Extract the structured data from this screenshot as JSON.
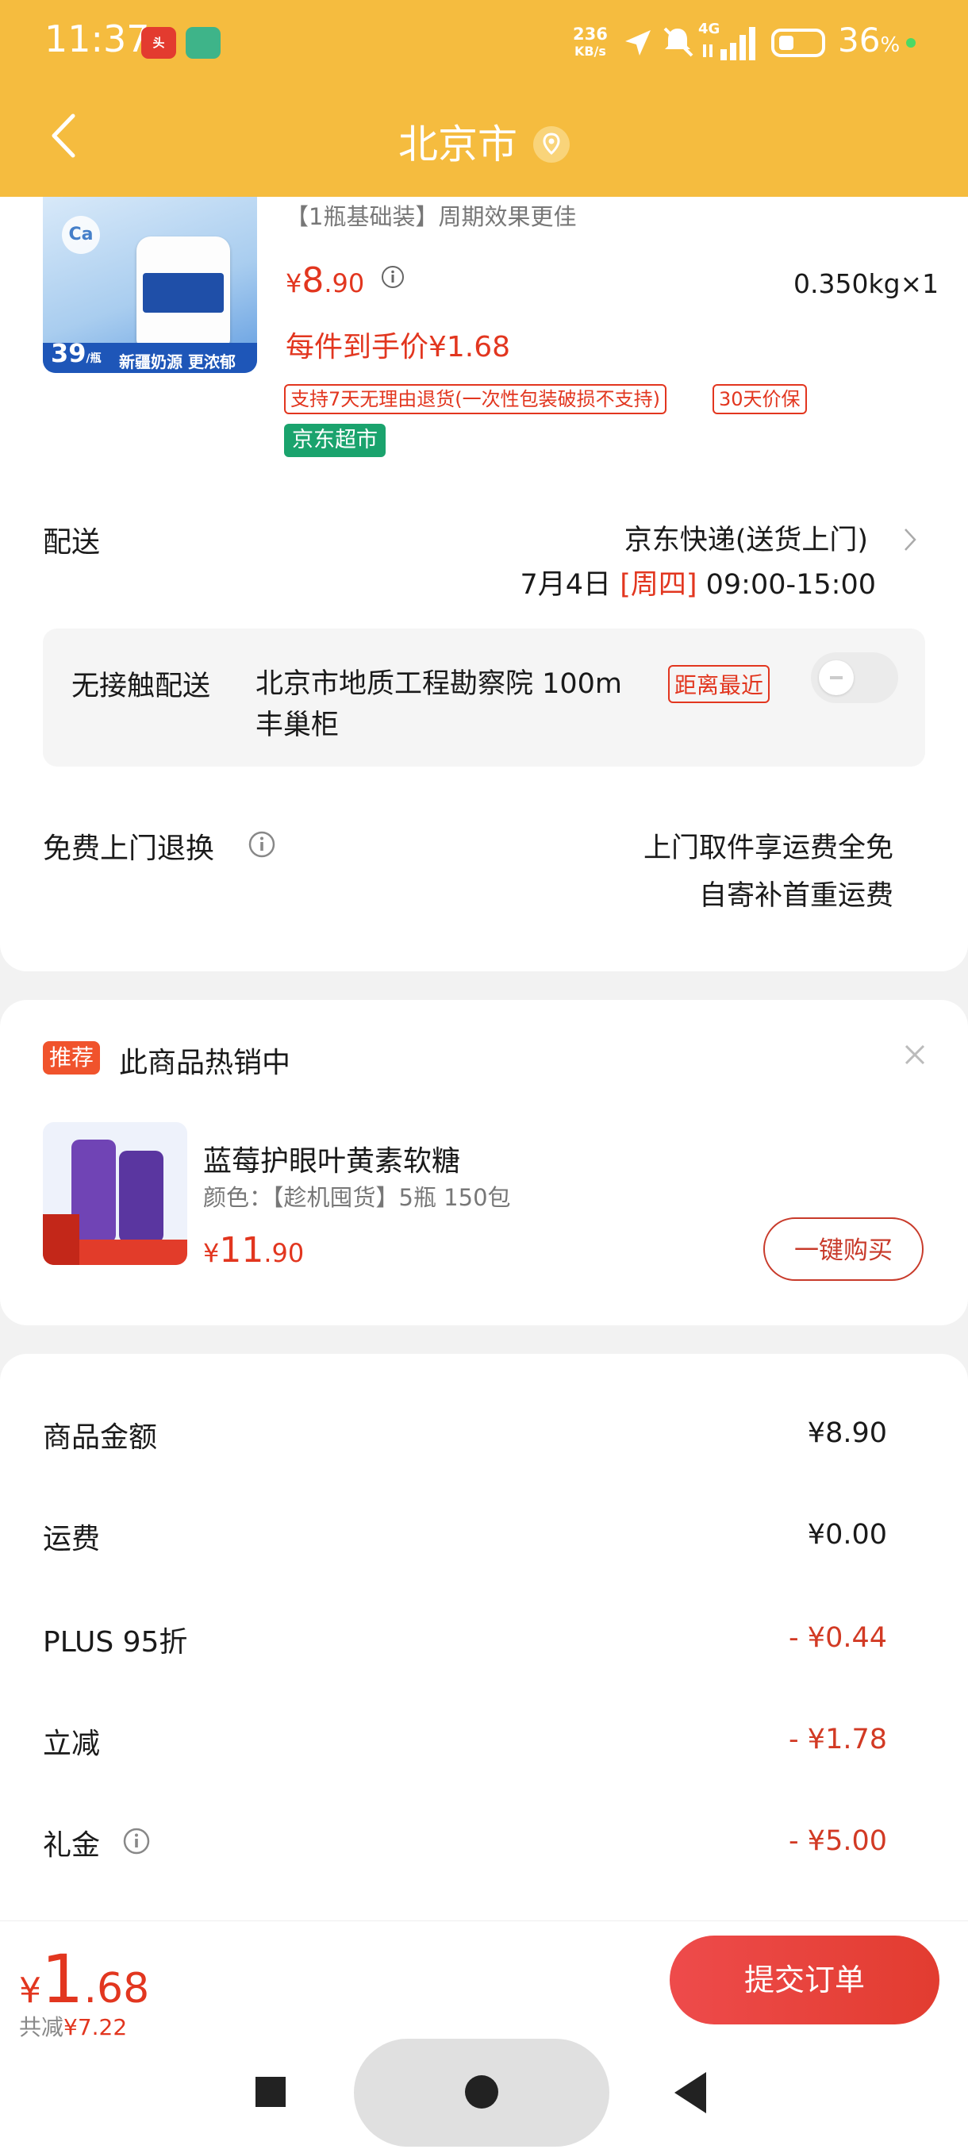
{
  "status_bar": {
    "time": "11:37",
    "app1_icon": "news-app-icon",
    "app2_icon": "app-icon",
    "speed_value": "236",
    "speed_unit": "KB/s",
    "network": "4G",
    "battery": "36",
    "battery_suffix": "%"
  },
  "header": {
    "title": "北京市",
    "bg_color": "#f5bc3f"
  },
  "product": {
    "spec": "【1瓶基础装】周期效果更佳",
    "price_symbol": "¥",
    "price_int": "8",
    "price_dec": ".90",
    "weight": "0.350kg×1",
    "final_price": "每件到手价¥1.68",
    "tags": [
      "支持7天无理由退货(一次性包装破损不支持)",
      "30天价保"
    ],
    "store_badge": "京东超市",
    "image": {
      "price_int": "39",
      "price_unit": "/瓶",
      "band_text": "新疆奶源 更浓郁",
      "element": "Ca"
    }
  },
  "delivery": {
    "label": "配送",
    "method": "京东快递(送货上门)",
    "date": "7月4日",
    "weekday": "[周四]",
    "window": "09:00-15:00"
  },
  "contactless": {
    "label": "无接触配送",
    "address": "北京市地质工程勘察院  100m",
    "address_line2": "丰巢柜",
    "badge": "距离最近",
    "enabled": false
  },
  "free_return": {
    "label": "免费上门退换",
    "line1": "上门取件享运费全免",
    "line2": "自寄补首重运费"
  },
  "recommend": {
    "badge": "推荐",
    "title": "此商品热销中",
    "name": "蓝莓护眼叶黄素软糖",
    "variant": "颜色：【趁机囤货】5瓶 150包",
    "price_symbol": "¥",
    "price_int": "11",
    "price_dec": ".90",
    "buy_label": "一键购买"
  },
  "summary": [
    {
      "label": "商品金额",
      "value": "¥8.90",
      "red": false
    },
    {
      "label": "运费",
      "value": "¥0.00",
      "red": false
    },
    {
      "label": "PLUS 95折",
      "value": "- ¥0.44",
      "red": true
    },
    {
      "label": "立减",
      "value": "- ¥1.78",
      "red": true
    },
    {
      "label": "礼金",
      "value": "- ¥5.00",
      "red": true
    }
  ],
  "bottom": {
    "total_symbol": "¥",
    "total_int": "1",
    "total_dec": ".68",
    "saved_label": "共减",
    "saved_amount": "¥7.22",
    "submit_label": "提交订单"
  },
  "colors": {
    "accent_red": "#e2361f",
    "header_yellow": "#f5bc3f",
    "jd_green": "#1aa36d"
  }
}
